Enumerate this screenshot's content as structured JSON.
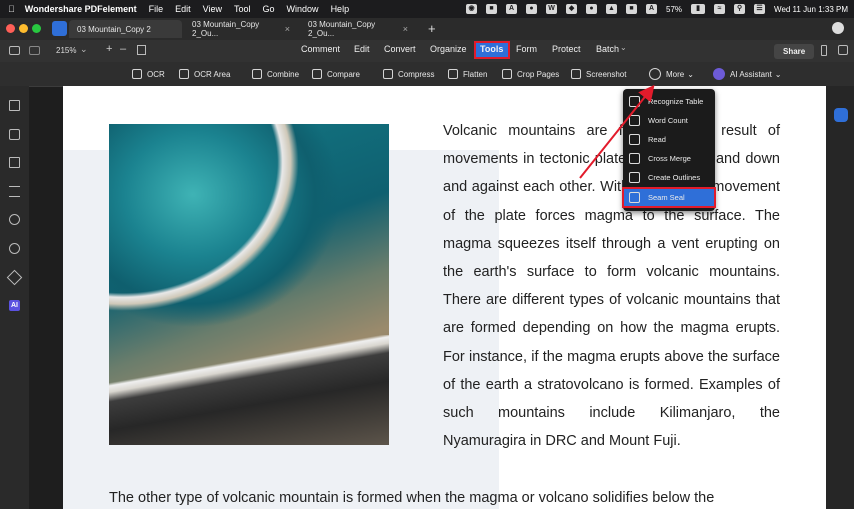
{
  "menubar": {
    "app_name": "Wondershare PDFelement",
    "items": [
      "File",
      "Edit",
      "View",
      "Tool",
      "Go",
      "Window",
      "Help"
    ],
    "battery": "57%",
    "datetime": "Wed 11 Jun  1:33 PM"
  },
  "tabs": [
    {
      "label": "03 Mountain_Copy 2"
    },
    {
      "label": "03 Mountain_Copy 2_Ou..."
    },
    {
      "label": "03 Mountain_Copy 2_Ou..."
    }
  ],
  "toolbar1": {
    "zoom": "215%",
    "menu_tabs": [
      "Comment",
      "Edit",
      "Convert",
      "Organize",
      "Tools",
      "Form",
      "Protect",
      "Batch"
    ],
    "active_tab": "Tools",
    "share": "Share"
  },
  "toolbar2": {
    "tools": [
      "OCR",
      "OCR Area",
      "Combine",
      "Compare",
      "Compress",
      "Flatten",
      "Crop Pages",
      "Screenshot",
      "More",
      "AI Assistant"
    ]
  },
  "dropdown": {
    "items": [
      "Recognize Table",
      "Word Count",
      "Read",
      "Cross Merge",
      "Create Outlines",
      "Seam Seal"
    ],
    "selected": "Seam Seal"
  },
  "document": {
    "paragraph1": "Volcanic mountains are formed as a result of movements in tectonic plates pushing up and down and against each other. With the random movement of the plate forces magma to the surface. The magma squeezes itself through a vent erupting on the earth's surface to form volcanic mountains. There are different types of volcanic mountains that are formed depending on how the magma erupts. For instance, if the magma erupts above the surface of the earth a stratovolcano is formed. Examples of such mountains include Kilimanjaro, the Nyamuragira in DRC and Mount Fuji.",
    "paragraph2": "The other type of volcanic mountain is formed when the magma or volcano solidifies below the"
  },
  "colors": {
    "highlight_red": "#e21b2b",
    "selection_blue": "#2f6fd8",
    "app_blue": "#2f6fd8"
  }
}
